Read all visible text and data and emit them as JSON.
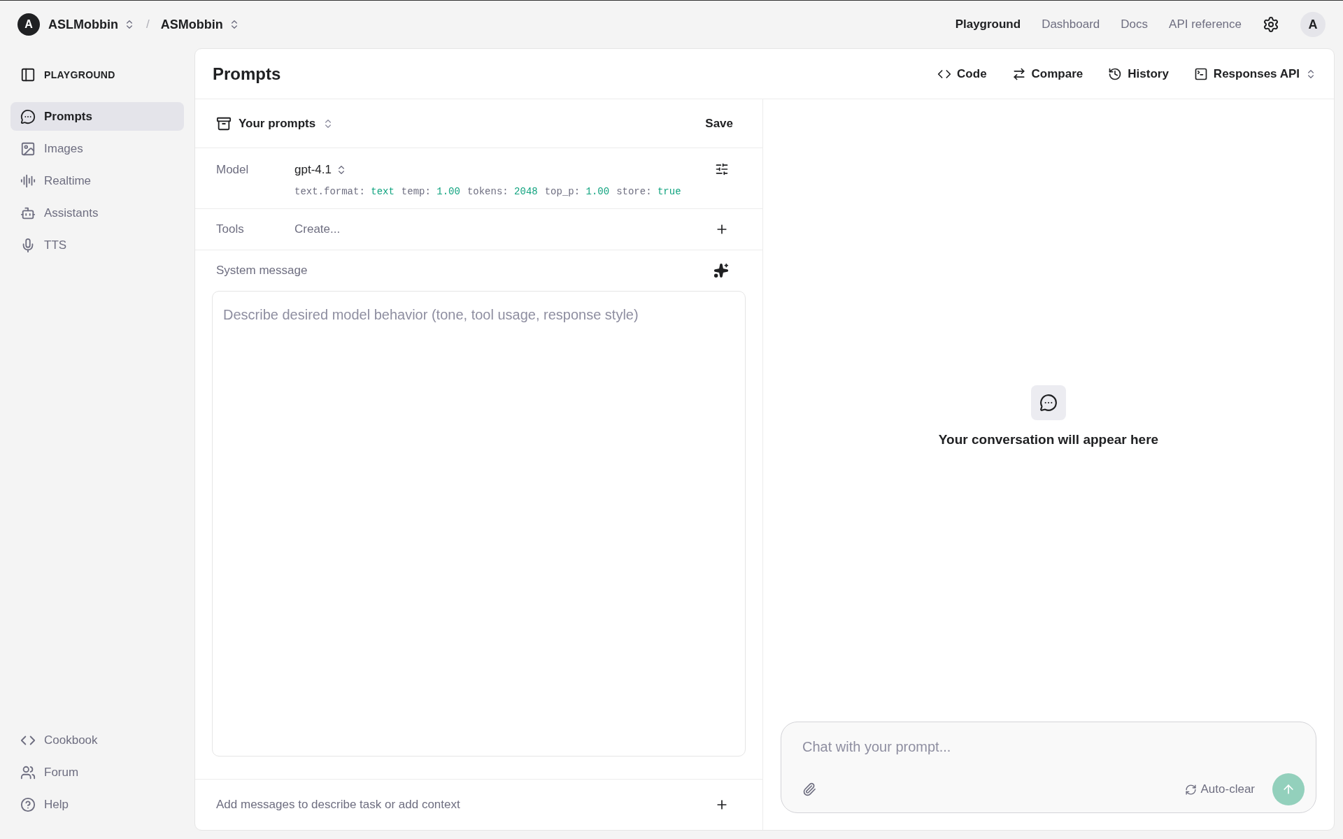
{
  "top_bar": {
    "breadcrumbs": [
      {
        "avatar": "A",
        "label": "ASLMobbin"
      },
      {
        "label": "ASMobbin"
      }
    ],
    "separator": "/",
    "nav": [
      {
        "label": "Playground",
        "selected": true
      },
      {
        "label": "Dashboard",
        "selected": false
      },
      {
        "label": "Docs",
        "selected": false
      },
      {
        "label": "API reference",
        "selected": false
      }
    ],
    "user_avatar": "A"
  },
  "sidebar": {
    "title": "PLAYGROUND",
    "items": [
      {
        "label": "Prompts",
        "selected": true
      },
      {
        "label": "Images",
        "selected": false
      },
      {
        "label": "Realtime",
        "selected": false
      },
      {
        "label": "Assistants",
        "selected": false
      },
      {
        "label": "TTS",
        "selected": false
      }
    ],
    "footer_items": [
      {
        "label": "Cookbook"
      },
      {
        "label": "Forum"
      },
      {
        "label": "Help"
      }
    ]
  },
  "page": {
    "title": "Prompts",
    "actions": [
      {
        "label": "Code",
        "dropdown": false
      },
      {
        "label": "Compare",
        "dropdown": false
      },
      {
        "label": "History",
        "dropdown": false
      },
      {
        "label": "Responses API",
        "dropdown": true
      }
    ]
  },
  "prompt_panel": {
    "selector": "Your prompts",
    "save": "Save",
    "model": {
      "label": "Model",
      "value": "gpt-4.1",
      "params": [
        {
          "key": "text.format:",
          "value": "text"
        },
        {
          "key": "temp:",
          "value": "1.00"
        },
        {
          "key": "tokens:",
          "value": "2048"
        },
        {
          "key": "top_p:",
          "value": "1.00"
        },
        {
          "key": "store:",
          "value": "true"
        }
      ]
    },
    "tools": {
      "label": "Tools",
      "value": "Create..."
    },
    "system_message": {
      "label": "System message",
      "placeholder": "Describe desired model behavior (tone, tool usage, response style)"
    },
    "add_messages": "Add messages to describe task or add context"
  },
  "chat_panel": {
    "empty_text": "Your conversation will appear here",
    "input": {
      "placeholder": "Chat with your prompt..."
    },
    "auto_clear": "Auto-clear"
  }
}
